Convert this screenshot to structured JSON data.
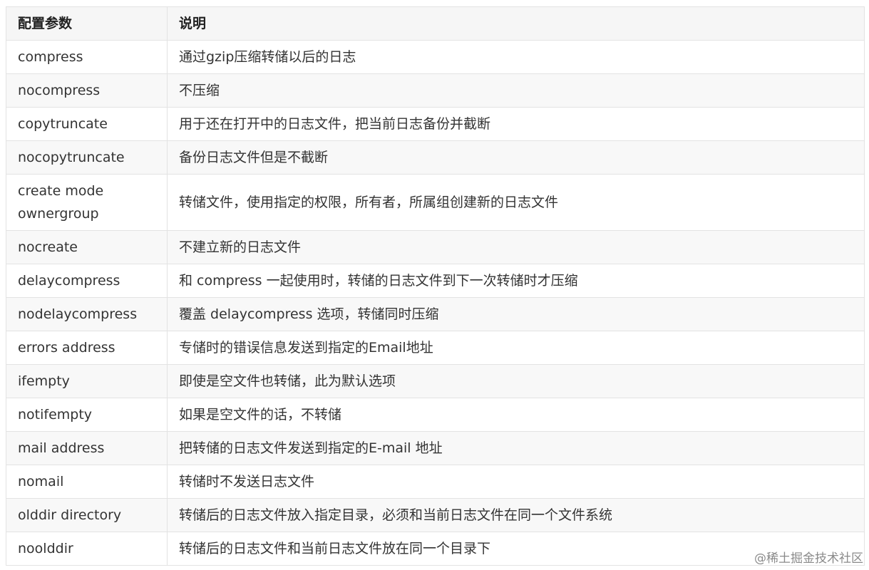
{
  "table": {
    "headers": [
      "配置参数",
      "说明"
    ],
    "rows": [
      {
        "param": "compress",
        "desc": "通过gzip压缩转储以后的日志"
      },
      {
        "param": "nocompress",
        "desc": "不压缩"
      },
      {
        "param": "copytruncate",
        "desc": "用于还在打开中的日志文件，把当前日志备份并截断"
      },
      {
        "param": "nocopytruncate",
        "desc": "备份日志文件但是不截断"
      },
      {
        "param": "create mode ownergroup",
        "desc": "转储文件，使用指定的权限，所有者，所属组创建新的日志文件"
      },
      {
        "param": "nocreate",
        "desc": "不建立新的日志文件"
      },
      {
        "param": "delaycompress",
        "desc": "和 compress 一起使用时，转储的日志文件到下一次转储时才压缩"
      },
      {
        "param": "nodelaycompress",
        "desc": "覆盖 delaycompress 选项，转储同时压缩"
      },
      {
        "param": "errors address",
        "desc": "专储时的错误信息发送到指定的Email地址"
      },
      {
        "param": "ifempty",
        "desc": "即使是空文件也转储，此为默认选项"
      },
      {
        "param": "notifempty",
        "desc": "如果是空文件的话，不转储"
      },
      {
        "param": "mail address",
        "desc": "把转储的日志文件发送到指定的E-mail 地址"
      },
      {
        "param": "nomail",
        "desc": "转储时不发送日志文件"
      },
      {
        "param": "olddir directory",
        "desc": "转储后的日志文件放入指定目录，必须和当前日志文件在同一个文件系统"
      },
      {
        "param": "noolddir",
        "desc": "转储后的日志文件和当前日志文件放在同一个目录下"
      }
    ]
  },
  "watermark": "@稀土掘金技术社区"
}
